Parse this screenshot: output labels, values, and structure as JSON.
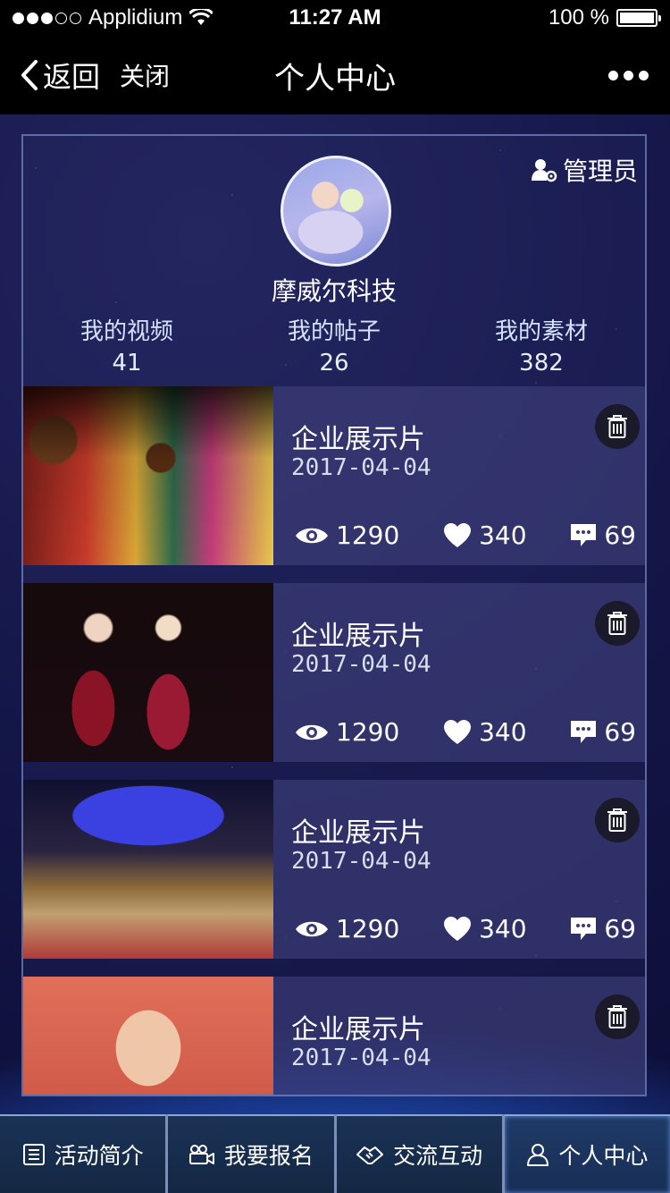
{
  "status_bar": {
    "carrier": "Applidium",
    "time": "11:27 AM",
    "battery_text": "100 %",
    "signal_strength": "3 of 5 dots filled",
    "battery_level": 1.0
  },
  "nav": {
    "back_label": "返回",
    "close_label": "关闭",
    "title": "个人中心"
  },
  "profile": {
    "role": "管理员",
    "name": "摩威尔科技",
    "stats": [
      {
        "label": "我的视频",
        "value": "41"
      },
      {
        "label": "我的帖子",
        "value": "26"
      },
      {
        "label": "我的素材",
        "value": "382"
      }
    ]
  },
  "videos": [
    {
      "title": "企业展示片",
      "date": "2017-04-04",
      "views": "1290",
      "likes": "340",
      "comments": "69"
    },
    {
      "title": "企业展示片",
      "date": "2017-04-04",
      "views": "1290",
      "likes": "340",
      "comments": "69"
    },
    {
      "title": "企业展示片",
      "date": "2017-04-04",
      "views": "1290",
      "likes": "340",
      "comments": "69"
    },
    {
      "title": "企业展示片",
      "date": "2017-04-04"
    }
  ],
  "tabbar": {
    "tabs": [
      {
        "label": "活动简介",
        "icon": "list-icon"
      },
      {
        "label": "我要报名",
        "icon": "video-camera-icon"
      },
      {
        "label": "交流互动",
        "icon": "handshake-icon"
      },
      {
        "label": "个人中心",
        "icon": "user-icon",
        "active": true
      }
    ]
  },
  "colors": {
    "accent_blue": "#2b6fd8",
    "background": "#141648",
    "tab_background": "#1a3256"
  }
}
